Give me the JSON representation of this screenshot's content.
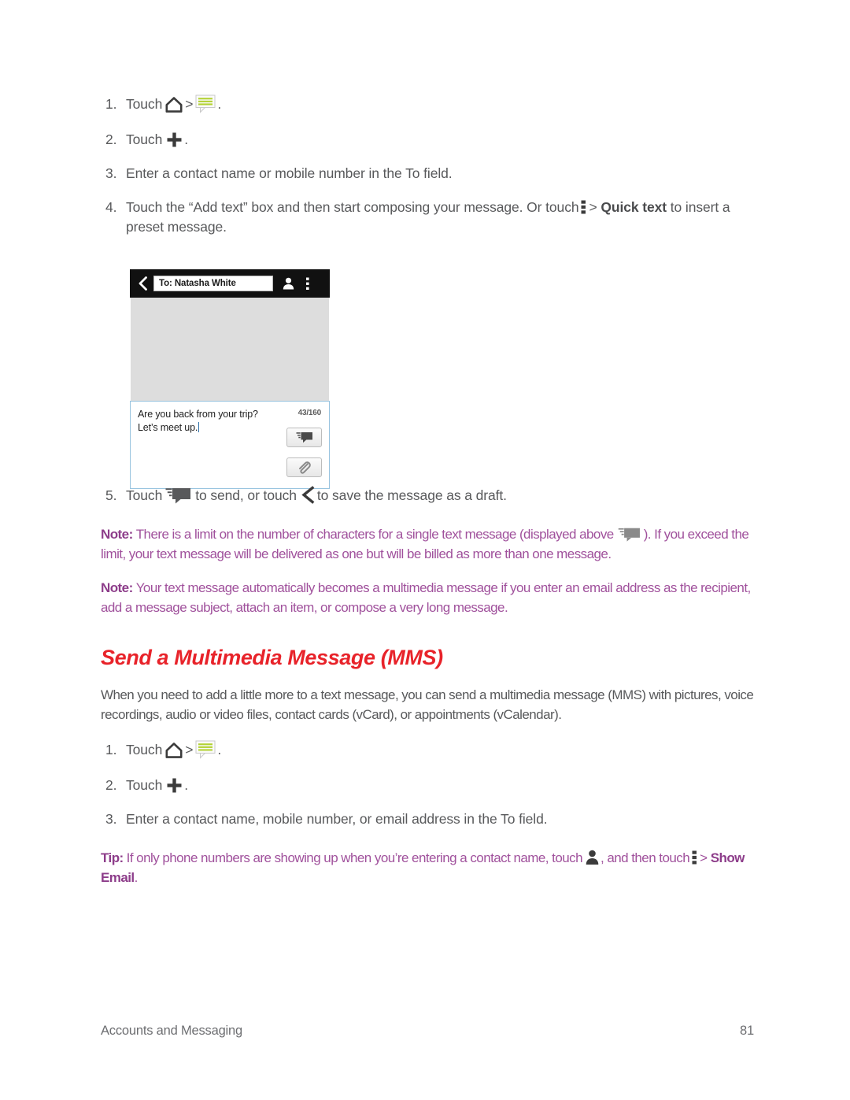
{
  "document": {
    "footer_section": "Accounts and Messaging",
    "page_number": "81"
  },
  "section_sms": {
    "steps": [
      {
        "num": "1.",
        "text_before": "Touch",
        "icons": [
          "home-icon",
          "message-icon"
        ],
        "separator": ">",
        "text_after": "."
      },
      {
        "num": "2.",
        "text_before": "Touch",
        "icons": [
          "plus-icon"
        ],
        "text_after": "."
      },
      {
        "num": "3.",
        "text": "Enter a contact name or mobile number in the To field."
      },
      {
        "num": "4.",
        "text_part1": "Touch the “Add text” box and then start composing your message. Or touch",
        "separator": ">",
        "bold_label": "Quick text",
        "text_part2": "to insert a preset message."
      },
      {
        "num": "5.",
        "text_part1": "Touch",
        "text_part2": "to send, or touch",
        "text_part3": "to save the message as a draft."
      }
    ]
  },
  "phone_screenshot": {
    "topbar": {
      "back_icon": "back-chevron-icon",
      "recipient_field_value": "To: Natasha White",
      "contact_icon": "person-icon",
      "overflow_icon": "overflow-menu-icon"
    },
    "compose": {
      "message_text": "Are you back from your trip? Let’s meet up.",
      "char_counter": "43/160",
      "send_button_icon": "send-icon",
      "attach_button_icon": "paperclip-icon"
    }
  },
  "notes": [
    {
      "label": "Note:",
      "text_part1": "There is a limit on the number of characters for a single text message (displayed above",
      "text_part2": "). If you exceed the limit, your text message will be delivered as one but will be billed as more than one message.",
      "inline_icon": "send-icon"
    },
    {
      "label": "Note:",
      "text": "Your text message automatically becomes a multimedia message if you enter an email address as the recipient, add a message subject, attach an item, or compose a very long message."
    }
  ],
  "section_mms": {
    "heading": "Send a Multimedia Message (MMS)",
    "intro": "When you need to add a little more to a text message, you can send a multimedia message (MMS) with pictures, voice recordings, audio or video files, contact cards (vCard), or appointments (vCalendar).",
    "steps": [
      {
        "num": "1.",
        "text_before": "Touch",
        "separator": ">",
        "text_after": "."
      },
      {
        "num": "2.",
        "text_before": "Touch",
        "text_after": "."
      },
      {
        "num": "3.",
        "text": "Enter a contact name, mobile number, or email address in the To field."
      }
    ],
    "tip": {
      "label": "Tip:",
      "text_part1": "If only phone numbers are showing up when you’re entering a contact name, touch",
      "text_part2": ", and then touch",
      "separator": ">",
      "bold_label": "Show Email",
      "text_part3": "."
    }
  },
  "colors": {
    "note_purple": "#a0519c",
    "heading_red": "#e8232a",
    "body_gray": "#58595b",
    "phone_topbar": "#111111",
    "thread_bg": "#dddddd",
    "compose_border": "#97c3df",
    "message_icon_green": "#b3d233"
  }
}
